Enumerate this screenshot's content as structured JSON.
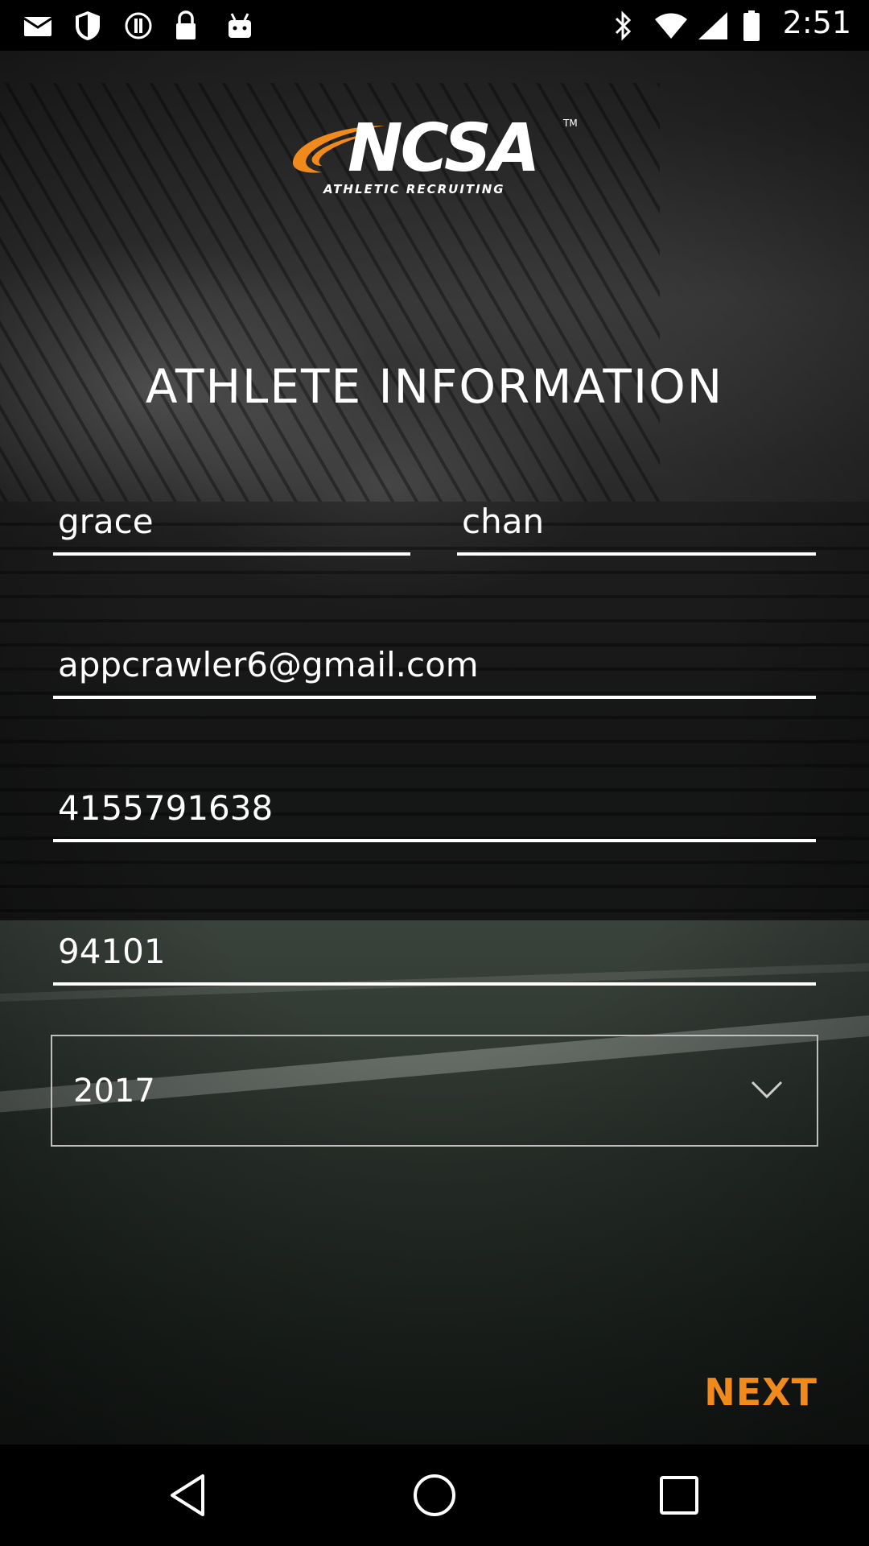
{
  "status_bar": {
    "time": "2:51",
    "left_icons": [
      "mail-icon",
      "shield-icon",
      "alert-icon",
      "lock-icon",
      "android-icon"
    ],
    "right_icons": [
      "bluetooth-icon",
      "wifi-icon",
      "signal-icon",
      "battery-icon"
    ]
  },
  "logo": {
    "name": "NCSA",
    "tm": "TM",
    "subtitle": "ATHLETIC RECRUITING",
    "accent_color": "#f08a1c"
  },
  "form": {
    "title": "ATHLETE INFORMATION",
    "first_name": "grace",
    "last_name": "chan",
    "email": "appcrawler6@gmail.com",
    "phone": "4155791638",
    "zip": "94101",
    "grad_year": "2017"
  },
  "actions": {
    "next_label": "NEXT",
    "next_color": "#f08a1c"
  },
  "nav_bar": {
    "icons": [
      "back-icon",
      "home-icon",
      "recents-icon"
    ]
  }
}
